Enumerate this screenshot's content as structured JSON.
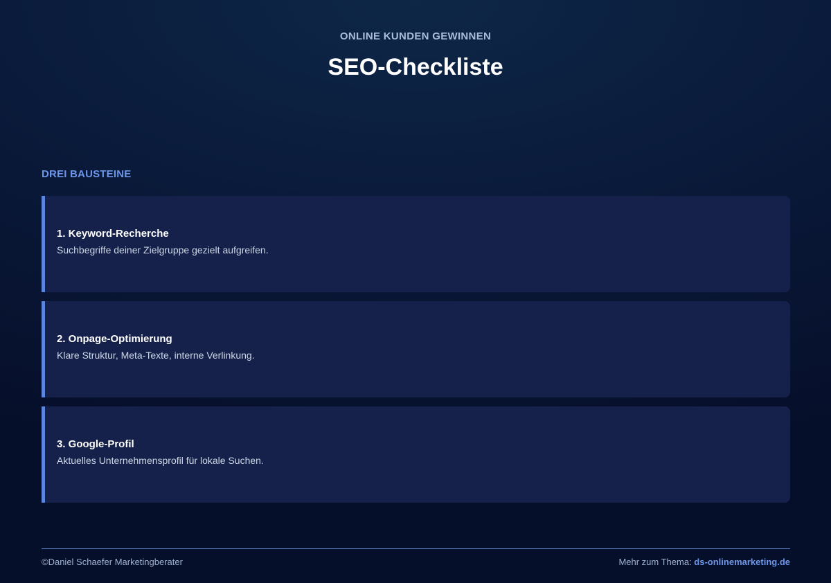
{
  "header": {
    "eyebrow": "ONLINE KUNDEN GEWINNEN",
    "title": "SEO-Checkliste"
  },
  "section": {
    "label": "DREI BAUSTEINE"
  },
  "items": [
    {
      "title": "1. Keyword-Recherche",
      "text": "Suchbegriffe deiner Zielgruppe gezielt aufgreifen."
    },
    {
      "title": "2. Onpage-Optimierung",
      "text": "Klare Struktur, Meta-Texte, interne Verlinkung."
    },
    {
      "title": "3. Google-Profil",
      "text": "Aktuelles Unternehmensprofil für lokale Suchen."
    }
  ],
  "footer": {
    "copyright": "©Daniel Schaefer Marketingberater",
    "more_label": "Mehr zum Thema: ",
    "link_text": "ds-onlinemarketing.de"
  },
  "colors": {
    "background": "#0a1a3a",
    "card": "#15214a",
    "accent": "#5b86e0",
    "link": "#6d95e8"
  }
}
